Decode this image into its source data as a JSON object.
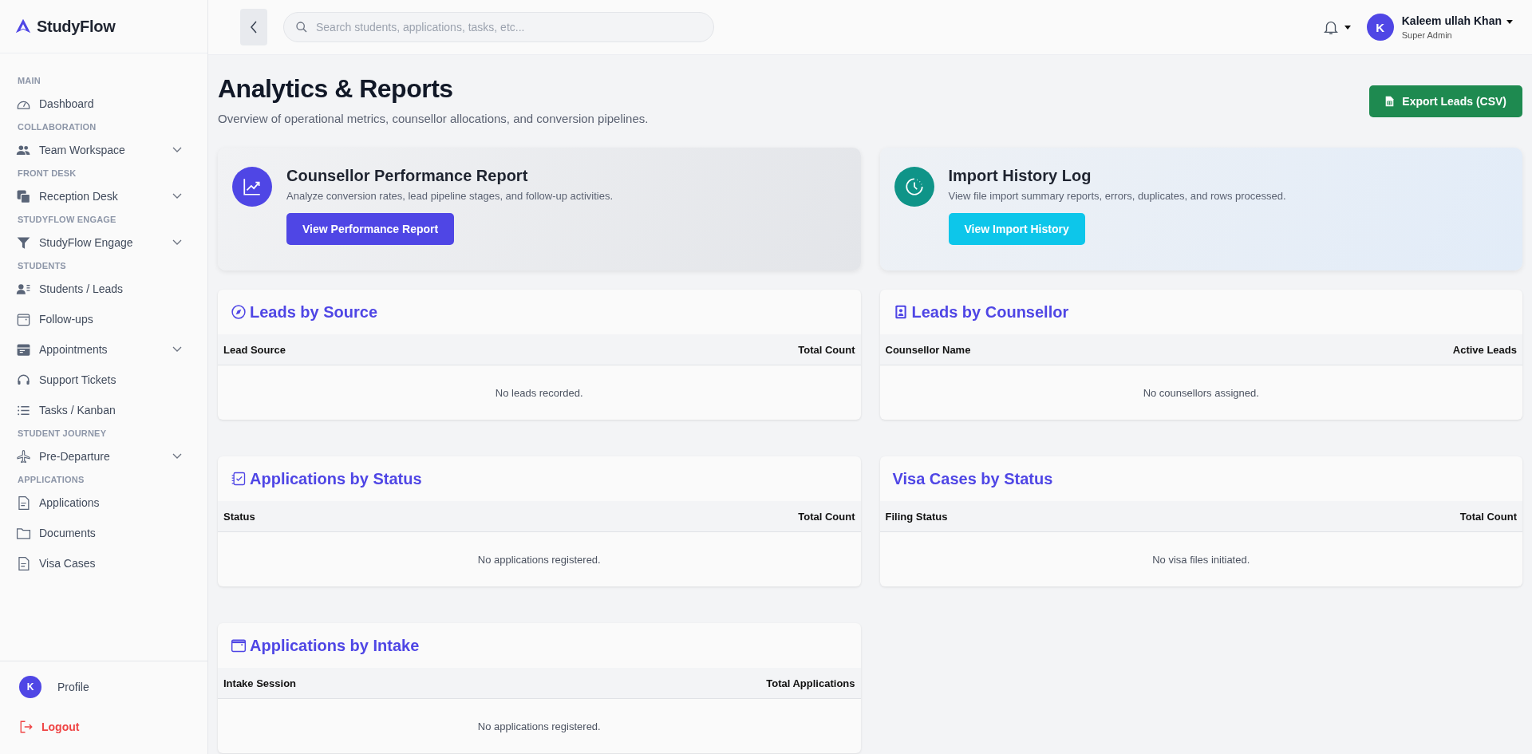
{
  "brand": {
    "name": "StudyFlow"
  },
  "sidebar": {
    "sections": [
      {
        "heading": "MAIN",
        "items": [
          {
            "label": "Dashboard",
            "expandable": false
          }
        ]
      },
      {
        "heading": "COLLABORATION",
        "items": [
          {
            "label": "Team Workspace",
            "expandable": true
          }
        ]
      },
      {
        "heading": "FRONT DESK",
        "items": [
          {
            "label": "Reception Desk",
            "expandable": true
          }
        ]
      },
      {
        "heading": "STUDYFLOW ENGAGE",
        "items": [
          {
            "label": "StudyFlow Engage",
            "expandable": true
          }
        ]
      },
      {
        "heading": "STUDENTS",
        "items": [
          {
            "label": "Students / Leads",
            "expandable": false
          },
          {
            "label": "Follow-ups",
            "expandable": false
          },
          {
            "label": "Appointments",
            "expandable": true
          },
          {
            "label": "Support Tickets",
            "expandable": false
          },
          {
            "label": "Tasks / Kanban",
            "expandable": false
          }
        ]
      },
      {
        "heading": "STUDENT JOURNEY",
        "items": [
          {
            "label": "Pre-Departure",
            "expandable": true
          }
        ]
      },
      {
        "heading": "APPLICATIONS",
        "items": [
          {
            "label": "Applications",
            "expandable": false
          },
          {
            "label": "Documents",
            "expandable": false
          },
          {
            "label": "Visa Cases",
            "expandable": false
          }
        ]
      }
    ],
    "profile": {
      "initial": "K",
      "label": "Profile"
    },
    "logout": "Logout"
  },
  "header": {
    "search": {
      "placeholder": "Search students, applications, tasks, etc..."
    },
    "user": {
      "initial": "K",
      "name": "Kaleem ullah Khan",
      "role": "Super Admin"
    }
  },
  "page": {
    "title": "Analytics & Reports",
    "subtitle": "Overview of operational metrics, counsellor allocations, and conversion pipelines.",
    "export_button": "Export Leads (CSV)"
  },
  "report_cards": [
    {
      "kind": "performance",
      "title": "Counsellor Performance Report",
      "description": "Analyze conversion rates, lead pipeline stages, and follow-up activities.",
      "button": "View Performance Report"
    },
    {
      "kind": "import",
      "title": "Import History Log",
      "description": "View file import summary reports, errors, duplicates, and rows processed.",
      "button": "View Import History"
    }
  ],
  "tables": [
    {
      "title": "Leads by Source",
      "columns": [
        "Lead Source",
        "Total Count"
      ],
      "empty_message": "No leads recorded."
    },
    {
      "title": "Leads by Counsellor",
      "columns": [
        "Counsellor Name",
        "Active Leads"
      ],
      "empty_message": "No counsellors assigned."
    },
    {
      "title": "Applications by Status",
      "columns": [
        "Status",
        "Total Count"
      ],
      "empty_message": "No applications registered."
    },
    {
      "title": "Visa Cases by Status",
      "columns": [
        "Filing Status",
        "Total Count"
      ],
      "empty_message": "No visa files initiated."
    },
    {
      "title": "Applications by Intake",
      "columns": [
        "Intake Session",
        "Total Applications"
      ],
      "empty_message": "No applications registered."
    }
  ]
}
